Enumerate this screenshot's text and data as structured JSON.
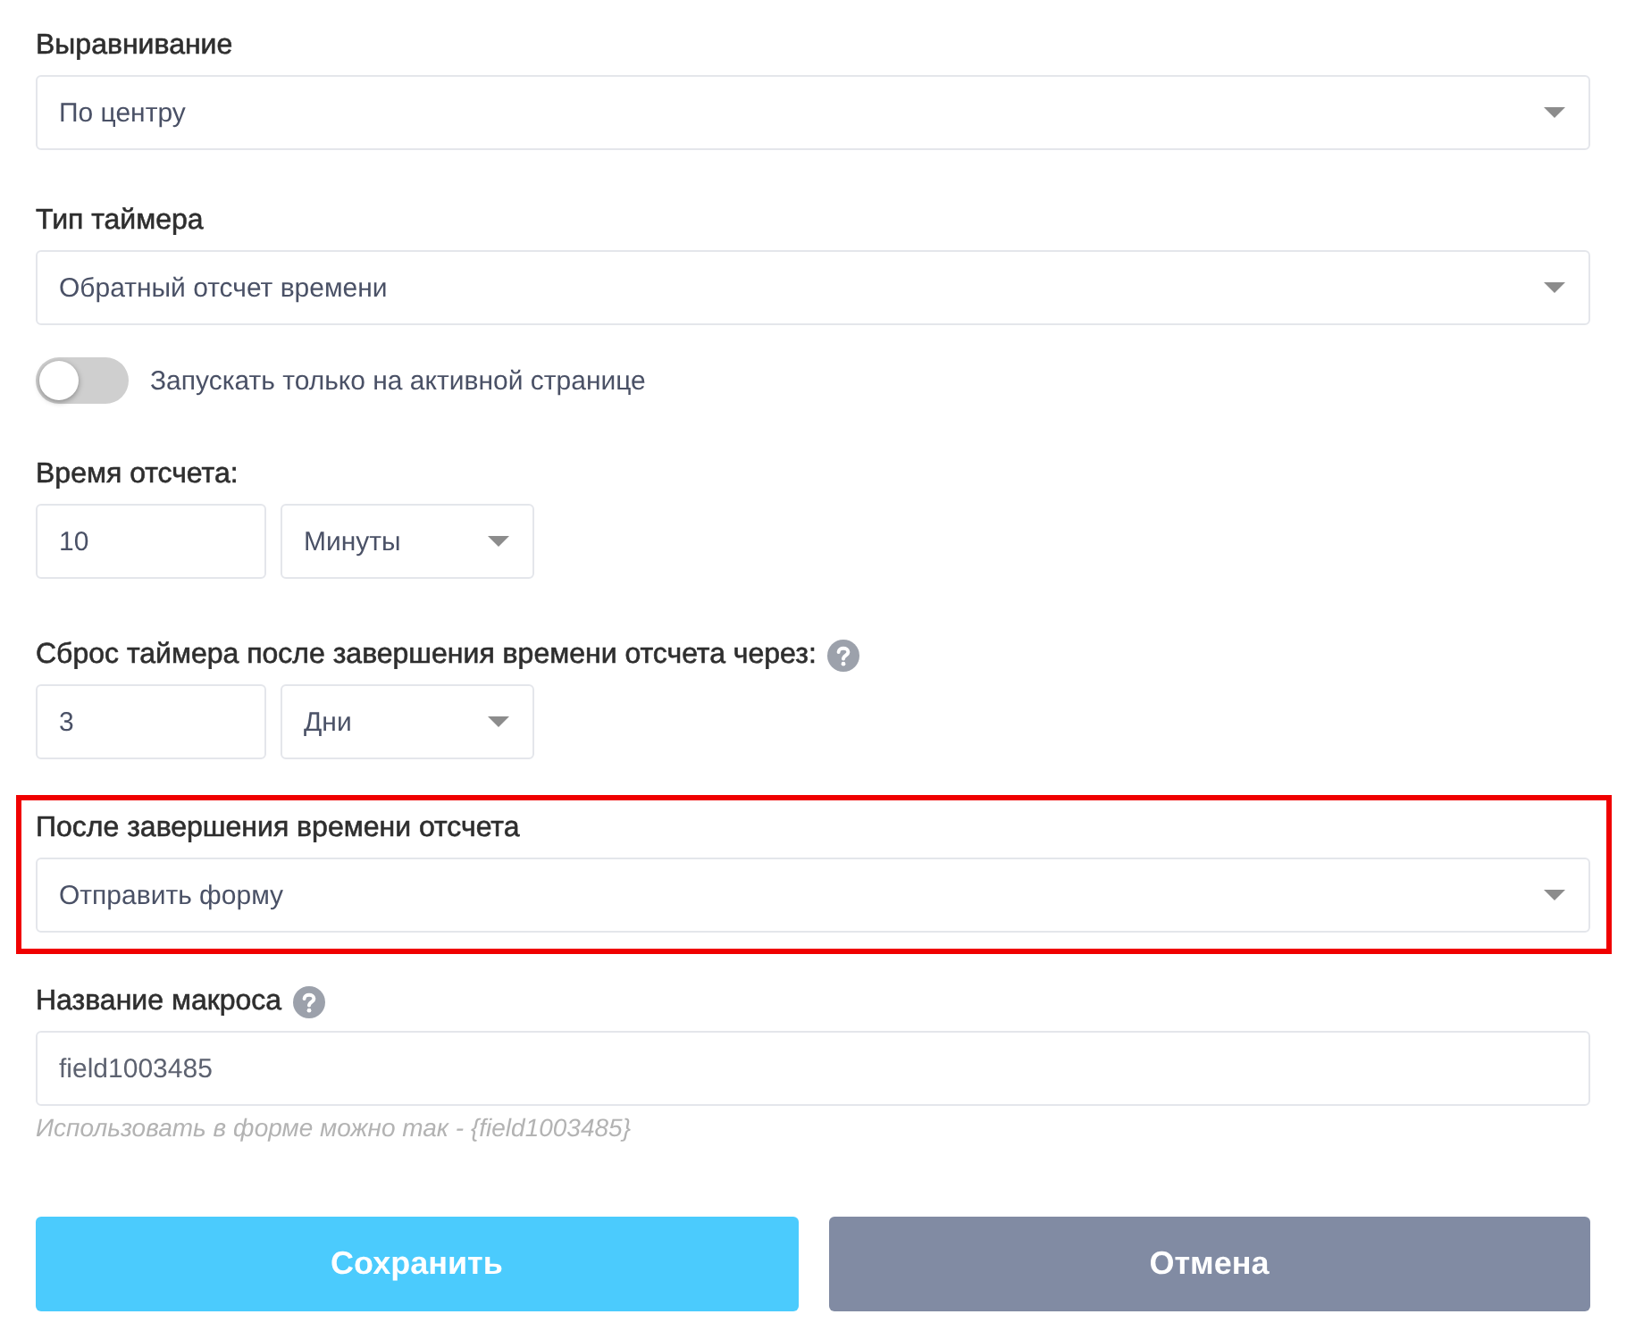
{
  "fields": [
    {
      "kind": "select",
      "label": "Выравнивание",
      "value": "По центру",
      "help": false,
      "highlighted": false
    },
    {
      "kind": "select",
      "label": "Тип таймера",
      "value": "Обратный отсчет времени",
      "help": false,
      "highlighted": false
    },
    {
      "kind": "toggle",
      "label": "Запускать только на активной странице",
      "on": false,
      "help": false,
      "highlighted": false
    },
    {
      "kind": "amount",
      "label": "Время отсчета:",
      "value": "10",
      "unit": "Минуты",
      "help": false,
      "highlighted": false
    },
    {
      "kind": "amount",
      "label": "Сброс таймера после завершения времени отсчета через:",
      "value": "3",
      "unit": "Дни",
      "help": true,
      "highlighted": false
    },
    {
      "kind": "select",
      "label": "После завершения времени отсчета",
      "value": "Отправить форму",
      "help": false,
      "highlighted": true
    },
    {
      "kind": "text",
      "label": "Название макроса",
      "value": "field1003485",
      "hint": "Использовать в форме можно так - {field1003485}",
      "help": true,
      "highlighted": false
    }
  ],
  "buttons": [
    {
      "kind": "primary",
      "label": "Сохранить"
    },
    {
      "kind": "secondary",
      "label": "Отмена"
    }
  ]
}
